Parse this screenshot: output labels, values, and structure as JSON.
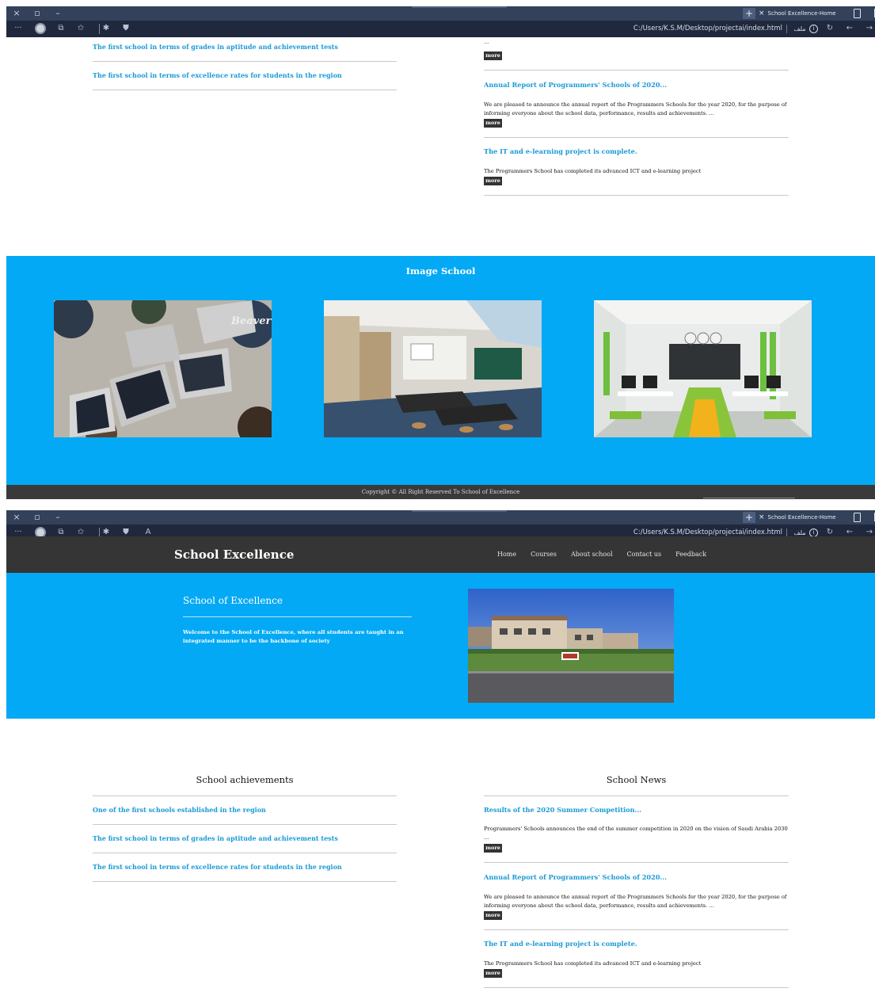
{
  "browser": {
    "tab_title": "School Excellence-Home",
    "tab_close": "×",
    "new_tab": "+",
    "url": "C:/Users/K.S.M/Desktop/projectai/index.html",
    "file_label": "ملف",
    "info": "i",
    "window_controls": [
      "×",
      "▫",
      "–"
    ],
    "toolbar_icons": [
      "more-dots-icon",
      "profile-avatar",
      "collections-icon",
      "favorites-star-icon",
      "extensions-icon",
      "shield-icon",
      "read-aloud-icon"
    ],
    "toolbar_glyphs": {
      "more": "···",
      "collections": "⧉",
      "favorites": "✩",
      "extension": "✱",
      "shield": "⛊",
      "read": "A",
      "refresh": "↻",
      "back": "←",
      "forward": "→"
    }
  },
  "header": {
    "site_title": "School Excellence",
    "nav": [
      "Home",
      "Courses",
      "About school",
      "Contact us",
      "Feedback"
    ]
  },
  "hero": {
    "title": "School of Excellence",
    "text": "Welcome to the School of Excellence, where all students are taught in an integrated manner to be the backbone of society"
  },
  "achievements": {
    "heading": "School achievements",
    "items": [
      "One of the first schools established in the region",
      "The first school in terms of grades in aptitude and achievement tests",
      "The first school in terms of excellence rates for students in the region"
    ]
  },
  "news": {
    "heading": "School News",
    "more_label": "more",
    "items": [
      {
        "title": "Results of the 2020 Summer Competition...",
        "text": "Programmers' Schools announces the end of the summer competition in 2020 on the vision of Saudi Arabia 2030 ..."
      },
      {
        "title": "Annual Report of Programmers' Schools of 2020...",
        "text": "We are pleased to announce the annual report of the Programmers Schools for the year 2020, for the purpose of informing everyone about the school data, performance, results and achievements. ..."
      },
      {
        "title": "The IT and e-learning project is complete.",
        "text": "The Programmers School has completed its advanced ICT and e-learning project"
      }
    ]
  },
  "gallery": {
    "heading": "Image School"
  },
  "footer": {
    "text": "Copyright © All Right Reserved To School of Excellence"
  },
  "colors": {
    "accent": "#03a9f4",
    "link": "#1a9ad6",
    "header_bg": "#353535",
    "browser_title_bg": "#33415a",
    "browser_addr_bg": "#20283d"
  }
}
